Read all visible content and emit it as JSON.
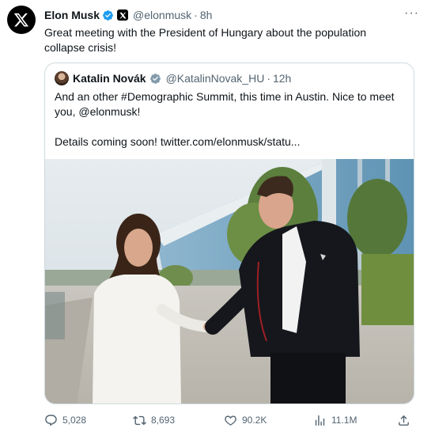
{
  "author": {
    "name": "Elon Musk",
    "handle": "@elonmusk",
    "time": "8h",
    "dot": "·",
    "more": "···"
  },
  "tweet_text": "Great meeting with the President of Hungary about the population collapse crisis!",
  "quote": {
    "name": "Katalin Novák",
    "handle": "@KatalinNovak_HU",
    "dot": "·",
    "time": "12h",
    "line1": "And an other #Demographic Summit, this time in Austin. Nice to meet",
    "line2": "you, @elonmusk!",
    "line3": "Details coming soon! twitter.com/elonmusk/statu..."
  },
  "actions": {
    "replies": "5,028",
    "retweets": "8,693",
    "likes": "90.2K",
    "views": "11.1M"
  },
  "colors": {
    "verified_blue": "#1d9bf0",
    "verified_gray": "#829aab",
    "muted_text": "#536471",
    "border": "#cfd9de"
  },
  "icons": [
    "x-logo-icon",
    "verified-badge-icon",
    "x-affiliate-badge-icon",
    "more-icon",
    "reply-icon",
    "retweet-icon",
    "like-icon",
    "views-icon",
    "share-icon"
  ]
}
